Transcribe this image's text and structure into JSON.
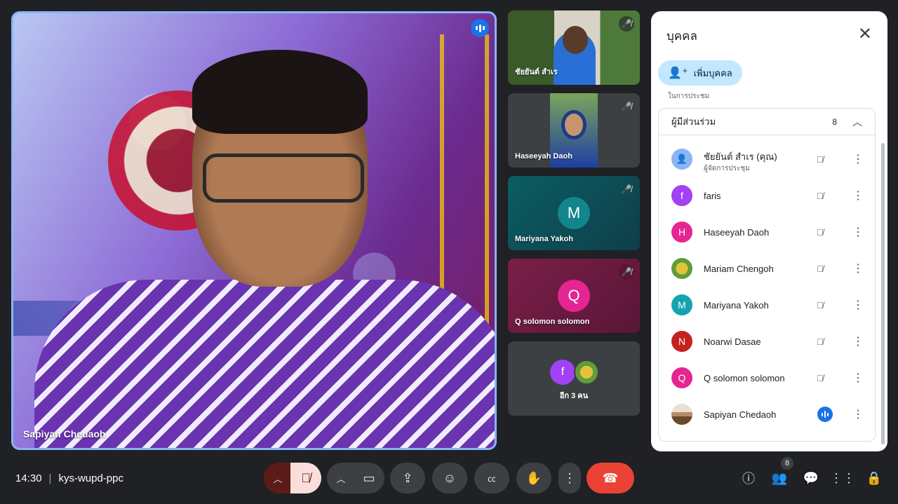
{
  "main_tile": {
    "name": "Sapiyan Chedaoh",
    "status": "speaking"
  },
  "side_tiles": [
    {
      "name": "ชัยยันต์ สำเร",
      "type": "video",
      "muted": true
    },
    {
      "name": "Haseeyah Daoh",
      "type": "video",
      "muted": true
    },
    {
      "name": "Mariyana Yakoh",
      "type": "avatar",
      "letter": "M",
      "color": "#12868a",
      "muted": true
    },
    {
      "name": "Q solomon solomon",
      "type": "avatar",
      "letter": "Q",
      "color": "#e52592",
      "muted": true
    },
    {
      "name": "อีก 3 คน",
      "type": "group",
      "letter": "f",
      "color": "#a142f4"
    }
  ],
  "panel": {
    "title": "บุคคล",
    "add_label": "เพิ่มบุคคล",
    "cut_label": "ในการประชุม",
    "section": {
      "label": "ผู้มีส่วนร่วม",
      "count": "8"
    },
    "participants": [
      {
        "name": "ชัยยันต์ สำเร (คุณ)",
        "sub": "ผู้จัดการประชุม",
        "letter": "",
        "color": "#8ab4f8",
        "mic": "muted"
      },
      {
        "name": "faris",
        "sub": "",
        "letter": "f",
        "color": "#a142f4",
        "mic": "muted"
      },
      {
        "name": "Haseeyah Daoh",
        "sub": "",
        "letter": "H",
        "color": "#e52592",
        "mic": "muted"
      },
      {
        "name": "Mariam Chengoh",
        "sub": "",
        "letter": "",
        "color": "#5f9d3a",
        "mic": "muted"
      },
      {
        "name": "Mariyana Yakoh",
        "sub": "",
        "letter": "M",
        "color": "#12a4af",
        "mic": "muted"
      },
      {
        "name": "Noarwi Dasae",
        "sub": "",
        "letter": "N",
        "color": "#c5221f",
        "mic": "muted"
      },
      {
        "name": "Q solomon solomon",
        "sub": "",
        "letter": "Q",
        "color": "#e52592",
        "mic": "muted"
      },
      {
        "name": "Sapiyan Chedaoh",
        "sub": "",
        "letter": "",
        "color": "#b88a6a",
        "mic": "speaking"
      }
    ]
  },
  "bottom_bar": {
    "time": "14:30",
    "separator": "|",
    "meeting_code": "kys-wupd-ppc",
    "people_badge": "8"
  }
}
